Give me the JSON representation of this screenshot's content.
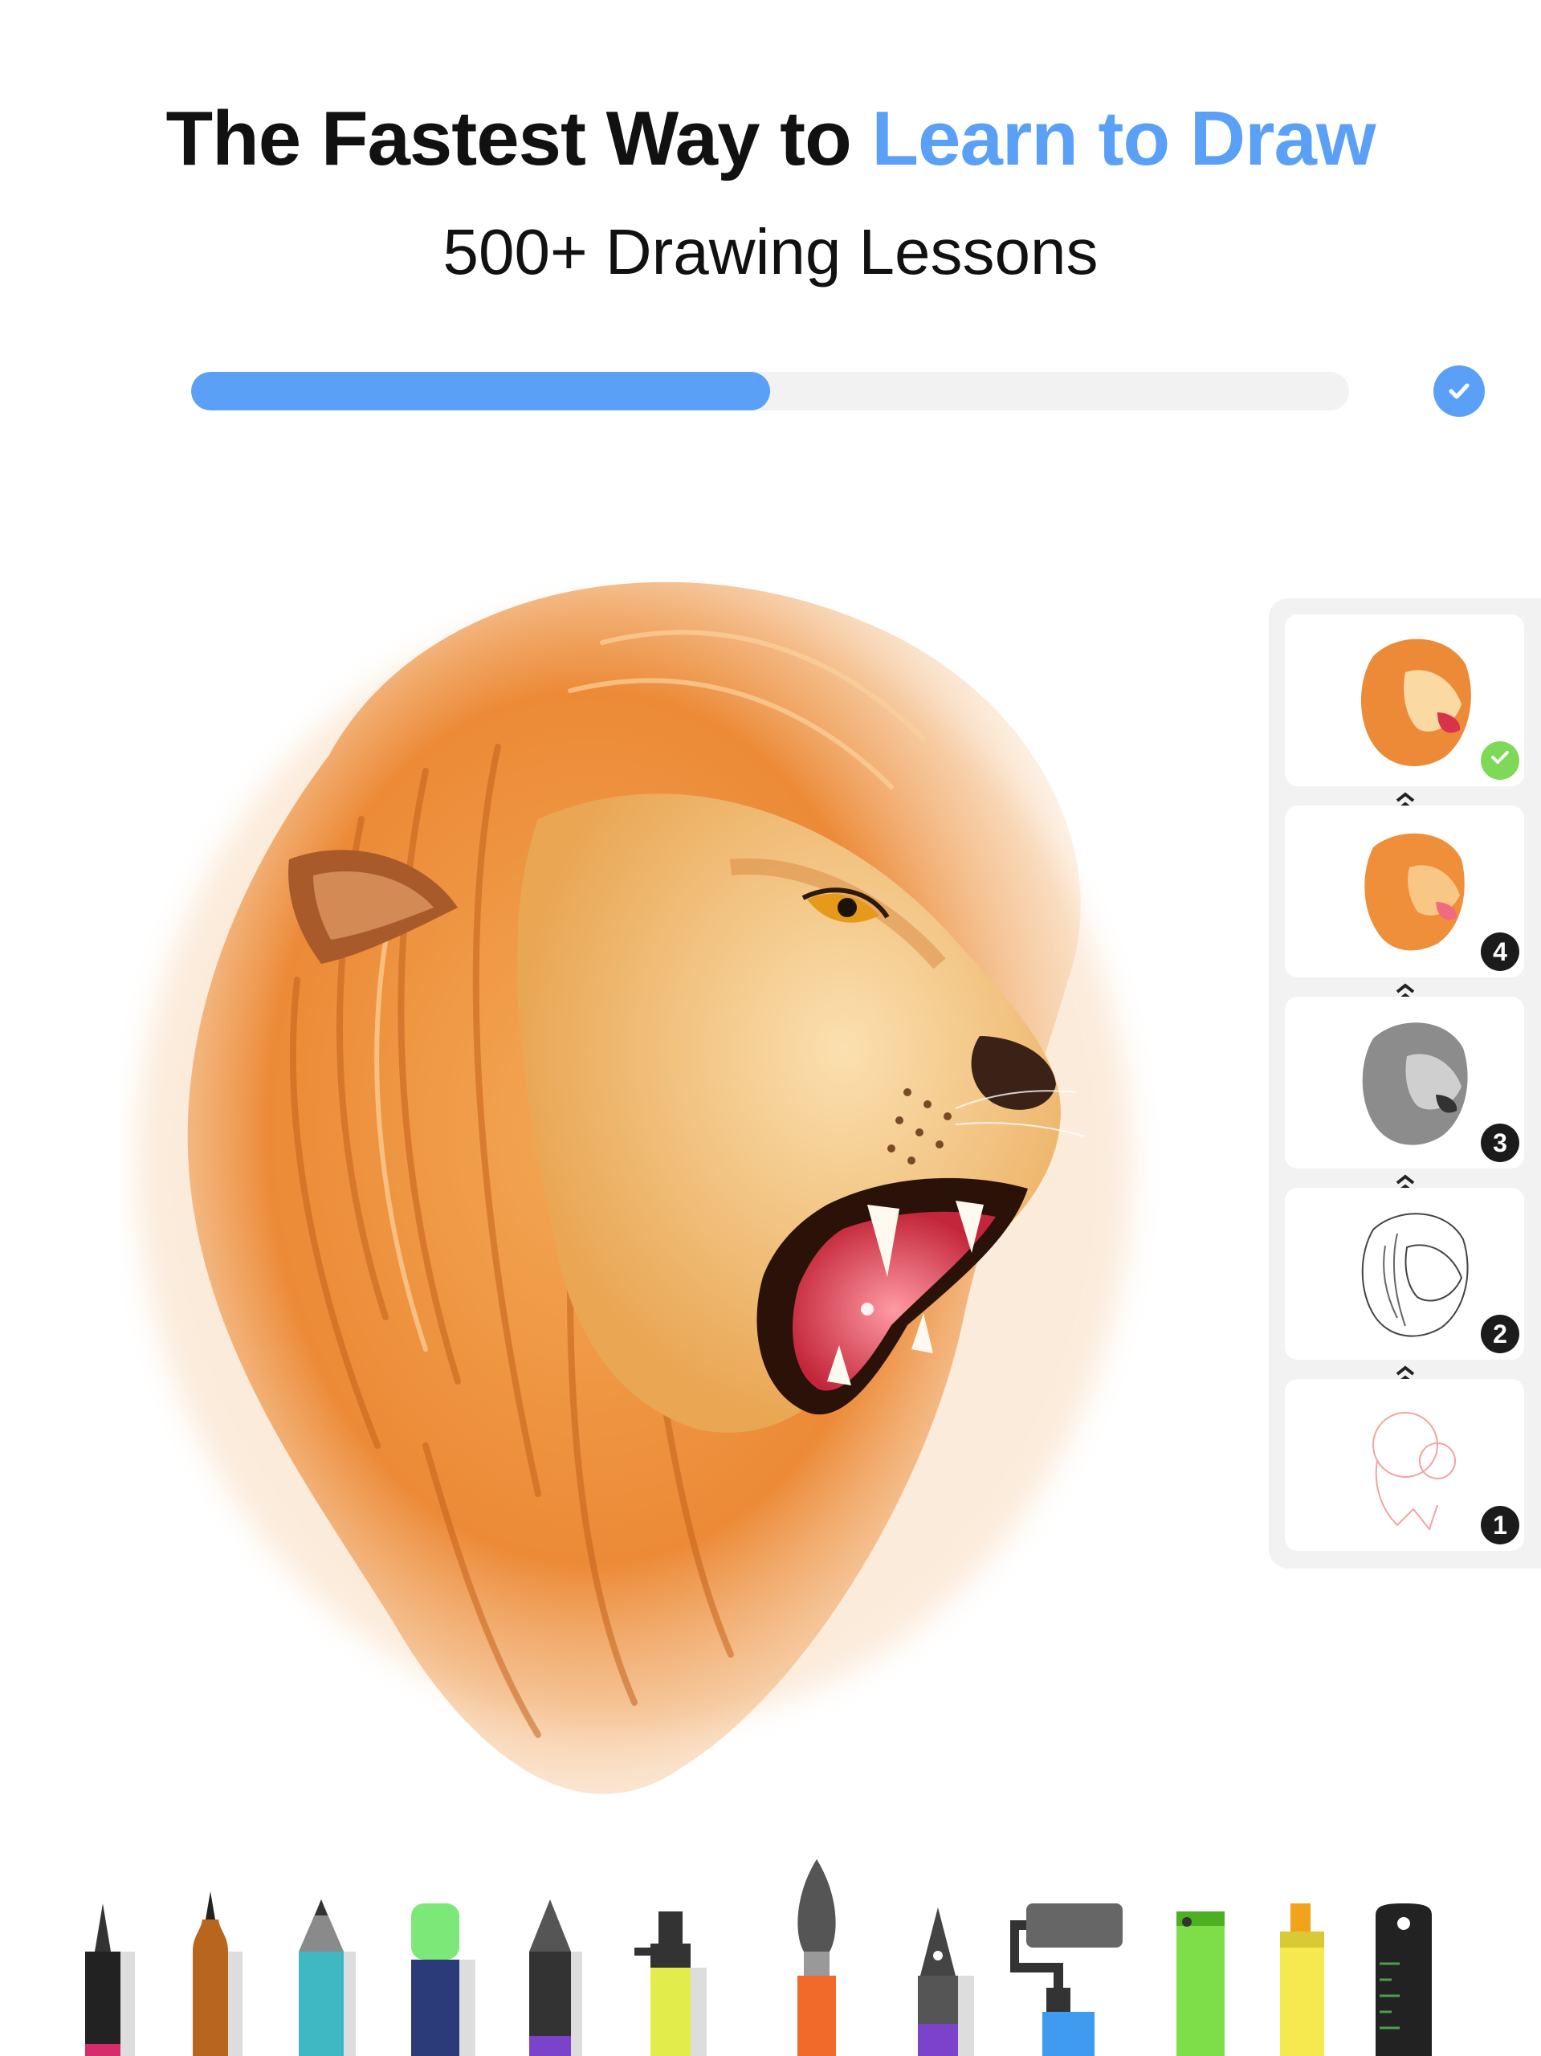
{
  "header": {
    "title_part1": "The Fastest Way to ",
    "title_accent": "Learn to Draw",
    "subtitle": "500+ Drawing Lessons",
    "accent_color": "#5ba0f7"
  },
  "progress": {
    "value": 0.5,
    "check_icon": "check-icon"
  },
  "canvas": {
    "subject": "lion-drawing"
  },
  "steps": [
    {
      "badge": "",
      "status": "done",
      "icon": "check-icon"
    },
    {
      "badge": "4",
      "status": "pending"
    },
    {
      "badge": "3",
      "status": "pending"
    },
    {
      "badge": "2",
      "status": "pending"
    },
    {
      "badge": "1",
      "status": "pending"
    }
  ],
  "tools": [
    {
      "name": "fineliner",
      "color": "#222222"
    },
    {
      "name": "ink-brush-pen",
      "color": "#b8651d"
    },
    {
      "name": "colored-pencil",
      "color": "#3fb8c4"
    },
    {
      "name": "marker",
      "color": "#7be877"
    },
    {
      "name": "graphite-pencil",
      "color": "#333333"
    },
    {
      "name": "airbrush",
      "color": "#e2ec4a"
    },
    {
      "name": "paint-brush",
      "color": "#f26a2a"
    },
    {
      "name": "fountain-pen",
      "color": "#7b43c9"
    },
    {
      "name": "paint-roller",
      "color": "#3f9bf0"
    },
    {
      "name": "green-marker",
      "color": "#7ede4a"
    },
    {
      "name": "highlighter",
      "color": "#f6e94f"
    },
    {
      "name": "ruler",
      "color": "#222222"
    }
  ]
}
